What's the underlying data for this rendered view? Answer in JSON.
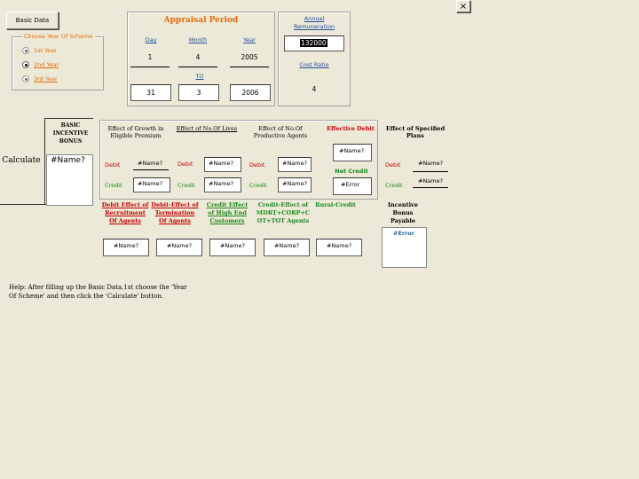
{
  "close_label": "×",
  "basic_data_label": "Basic Data",
  "scheme": {
    "legend": "Choose Year Of Scheme",
    "options": [
      "1st Year",
      "2nd Year",
      "3rd Year"
    ]
  },
  "appraisal": {
    "title": "Appraisal Period",
    "day_label": "Day",
    "month_label": "Month",
    "year_label": "Year",
    "from_day": "1",
    "from_month": "4",
    "from_year": "2005",
    "to_label": "TO",
    "to_day": "31",
    "to_month": "3",
    "to_year": "2006"
  },
  "remuneration": {
    "label": "Annual Remuneration",
    "value": "132000",
    "ratio_label": "Cost Ratio",
    "ratio_value": "4"
  },
  "incentive_bonus_label": "BASIC INCENTIVE BONUS",
  "calculate_label": "Calculate",
  "basic_value": "#Name?",
  "columns": {
    "growth": "Effect of Growth in Eligible Premium",
    "lives": "Effect of No.Of Lives",
    "agents": "Effect of No.Of Productive Agents",
    "effective_debit": "Effective Debit",
    "specified_plans": "Effect of Specified Plans"
  },
  "row_labels": {
    "debit": "Debit",
    "credit": "Credit"
  },
  "values": {
    "growth_debit": "#Name?",
    "growth_credit": "#Name?",
    "lives_debit": "#Name?",
    "lives_credit": "#Name?",
    "agents_debit": "#Name?",
    "agents_credit": "#Name?",
    "effective_debit": "#Name?",
    "net_credit_label": "Net Credit",
    "net_credit": "#Error",
    "plans_debit": "#Name?",
    "plans_credit": "#Name?"
  },
  "bottom": {
    "recruitment": "Debit Effect of Recruitment Of Agents",
    "termination": "Debit-Effect of Termination Of Agents",
    "highend": "Credit Effect of High End Customers",
    "mdrt": "Credit-Effect of MDRT+CORP+C OT+TOT Agents",
    "rural": "Rural-Credit",
    "recruitment_val": "#Name?",
    "termination_val": "#Name?",
    "highend_val": "#Name?",
    "mdrt_val": "#Name?",
    "rural_val": "#Name?",
    "payable_label": "Incentive Bonus Payable",
    "payable_val": "#Error"
  },
  "help_text": "Help: After filling up the Basic Data,1st choose the 'Year Of Scheme' and then click the 'Calculate' button."
}
